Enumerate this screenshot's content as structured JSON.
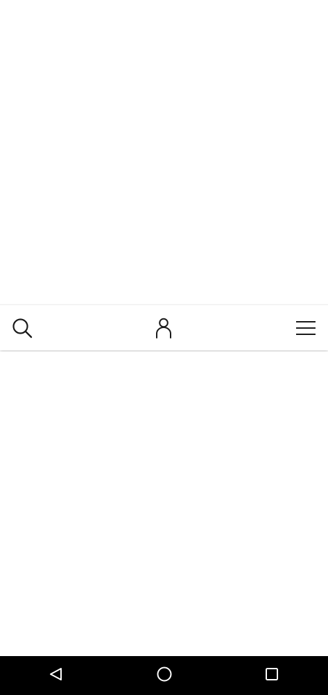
{
  "toolbar": {
    "icons": {
      "search": "search-icon",
      "account": "user-icon",
      "menu": "hamburger-menu-icon"
    },
    "background": "#ffffff",
    "icon_color": "#1a1a1a"
  },
  "system_nav": {
    "icons": {
      "back": "back-triangle-icon",
      "home": "home-circle-icon",
      "recents": "recents-square-icon"
    },
    "background": "#000000",
    "icon_color": "#ffffff"
  }
}
